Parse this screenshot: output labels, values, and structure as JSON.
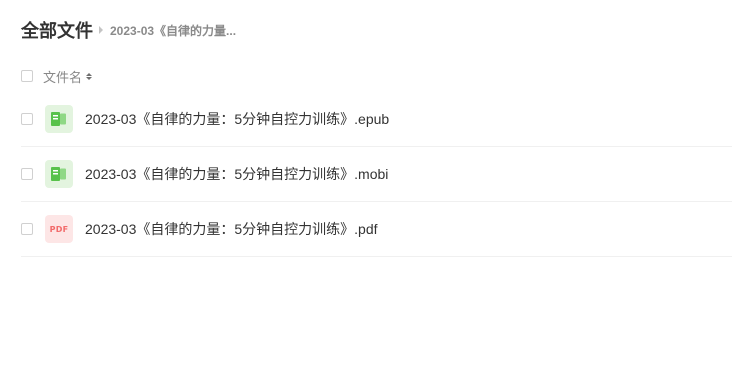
{
  "breadcrumb": {
    "root": "全部文件",
    "current": "2023-03《自律的力量..."
  },
  "list_header": {
    "name_column": "文件名",
    "sort_icon": "sort-caret-icon"
  },
  "files": [
    {
      "name": "2023-03《自律的力量：5分钟自控力训练》.epub",
      "icon": "ebook-icon",
      "icon_color": "#58c24b"
    },
    {
      "name": "2023-03《自律的力量：5分钟自控力训练》.mobi",
      "icon": "ebook-icon",
      "icon_color": "#58c24b"
    },
    {
      "name": "2023-03《自律的力量：5分钟自控力训练》.pdf",
      "icon": "pdf-icon",
      "icon_label": "PDF",
      "icon_color": "#f26b6b"
    }
  ]
}
